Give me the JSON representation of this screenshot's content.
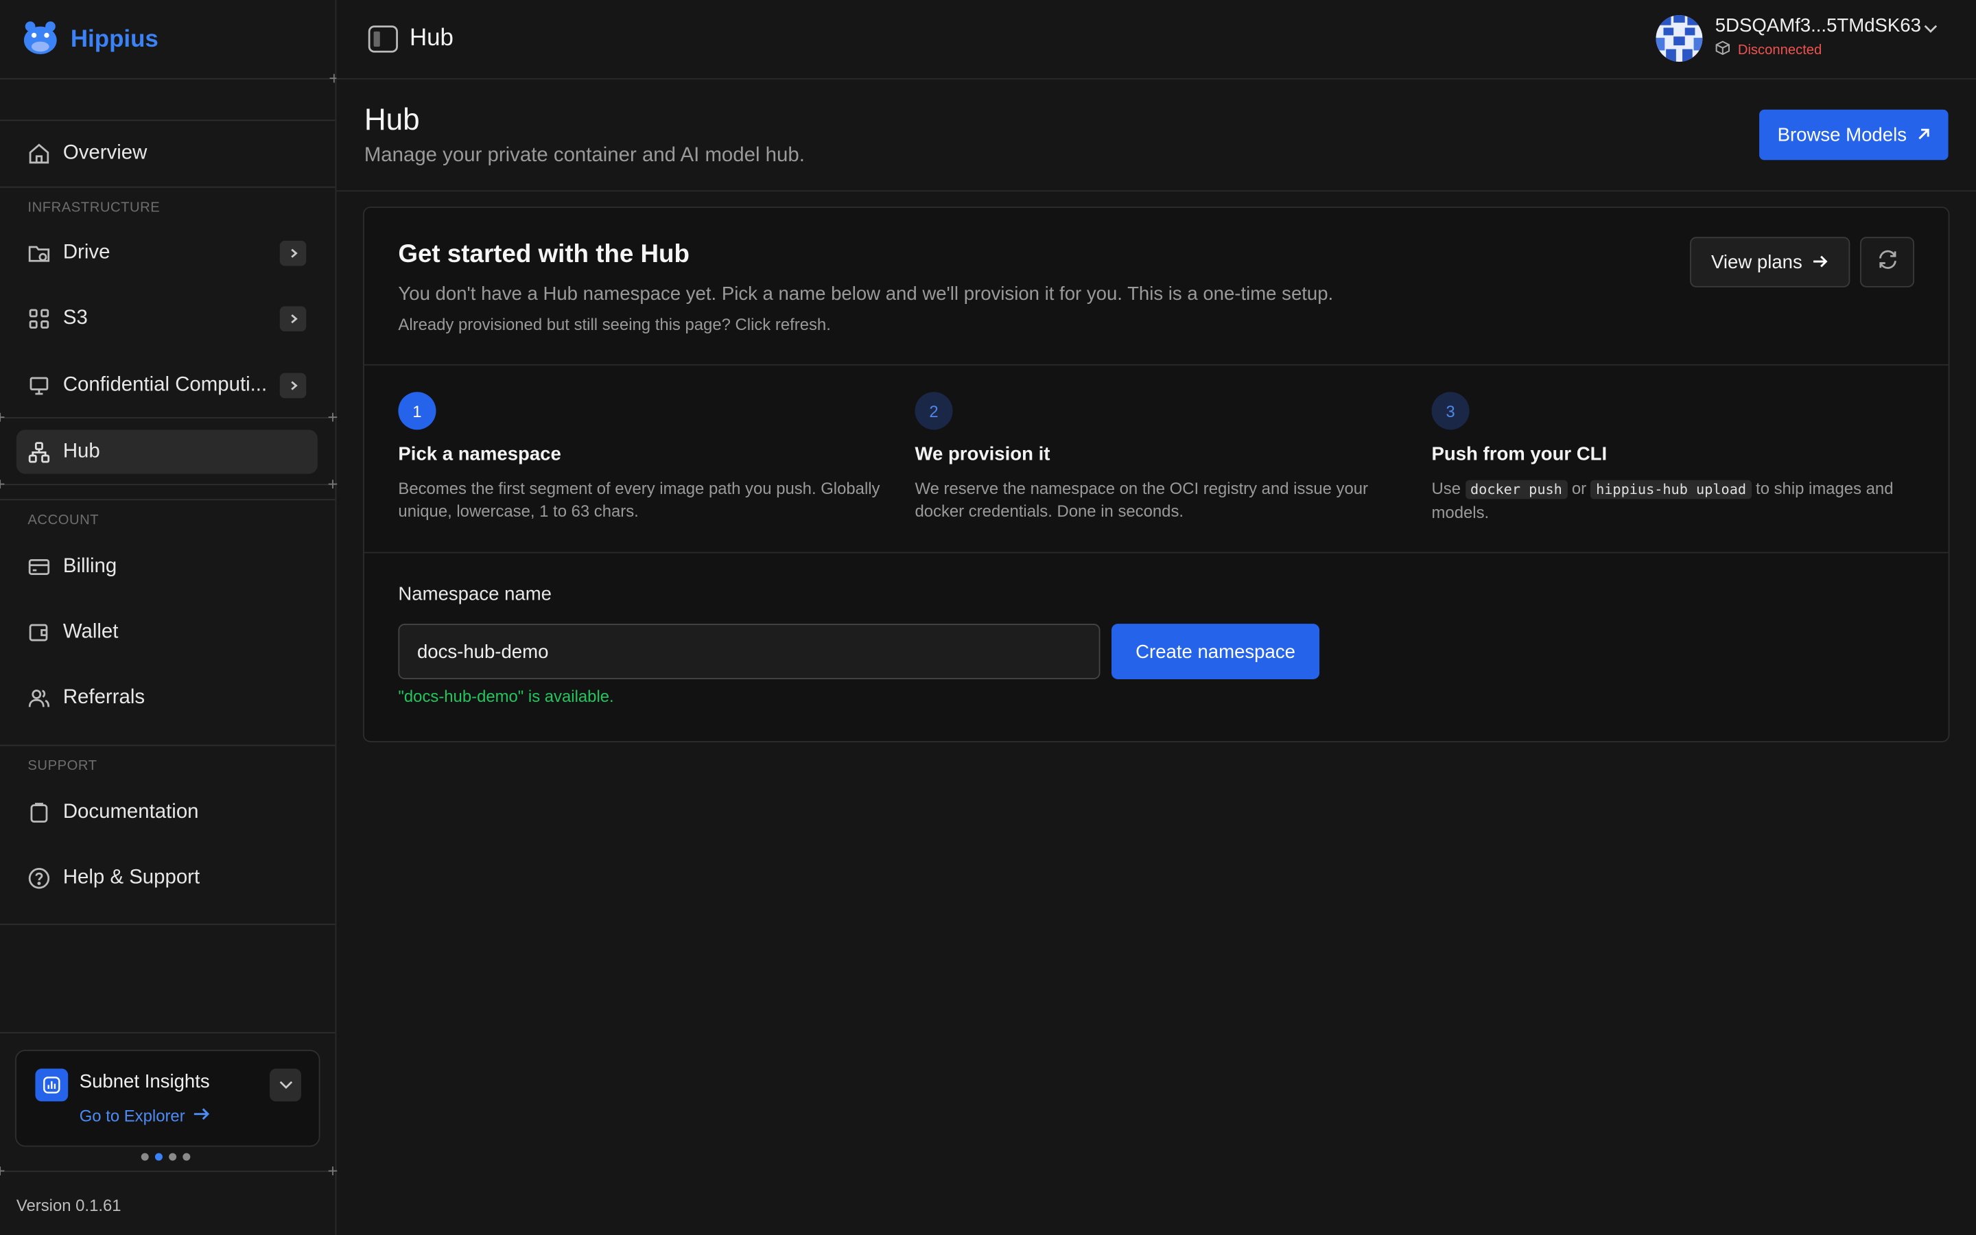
{
  "brand": {
    "name": "Hippius"
  },
  "sidebar": {
    "overview": "Overview",
    "sections": {
      "infrastructure": "INFRASTRUCTURE",
      "account": "ACCOUNT",
      "support": "SUPPORT"
    },
    "infrastructure_items": [
      {
        "label": "Drive",
        "icon": "folder-icon",
        "has_submenu": true
      },
      {
        "label": "S3",
        "icon": "grid-icon",
        "has_submenu": true
      },
      {
        "label": "Confidential Computi...",
        "icon": "monitor-icon",
        "has_submenu": true
      },
      {
        "label": "Hub",
        "icon": "network-icon",
        "active": true
      }
    ],
    "account_items": [
      {
        "label": "Billing",
        "icon": "credit-card-icon"
      },
      {
        "label": "Wallet",
        "icon": "wallet-icon"
      },
      {
        "label": "Referrals",
        "icon": "users-icon"
      }
    ],
    "support_items": [
      {
        "label": "Documentation",
        "icon": "clipboard-icon"
      },
      {
        "label": "Help & Support",
        "icon": "help-circle-icon"
      }
    ],
    "insights": {
      "title": "Subnet Insights",
      "link": "Go to Explorer",
      "carousel_active": 2,
      "carousel_total": 4
    },
    "version": "Version 0.1.61"
  },
  "topbar": {
    "title": "Hub",
    "account": {
      "name": "5DSQAMf3...5TMdSK63",
      "status": "Disconnected",
      "status_color": "#ef5350"
    }
  },
  "page": {
    "title": "Hub",
    "subtitle": "Manage your private container and AI model hub.",
    "browse_button": "Browse Models"
  },
  "card": {
    "title": "Get started with the Hub",
    "description": "You don't have a Hub namespace yet. Pick a name below and we'll provision it for you. This is a one-time setup.",
    "note": "Already provisioned but still seeing this page? Click refresh.",
    "view_plans": "View plans",
    "steps": [
      {
        "num": "1",
        "title": "Pick a namespace",
        "desc": "Becomes the first segment of every image path you push. Globally unique, lowercase, 1 to 63 chars."
      },
      {
        "num": "2",
        "title": "We provision it",
        "desc": "We reserve the namespace on the OCI registry and issue your docker credentials. Done in seconds."
      },
      {
        "num": "3",
        "title": "Push from your CLI",
        "desc_use": "Use",
        "code1": "docker push",
        "desc_or": "or",
        "code2": "hippius-hub upload",
        "desc_end": "to ship images and models."
      }
    ],
    "namespace": {
      "label": "Namespace name",
      "value": "docs-hub-demo",
      "button": "Create namespace",
      "status": "\"docs-hub-demo\" is available."
    }
  },
  "colors": {
    "accent": "#2563eb",
    "success": "#22c55e",
    "error": "#ef5350",
    "background": "#161616"
  }
}
